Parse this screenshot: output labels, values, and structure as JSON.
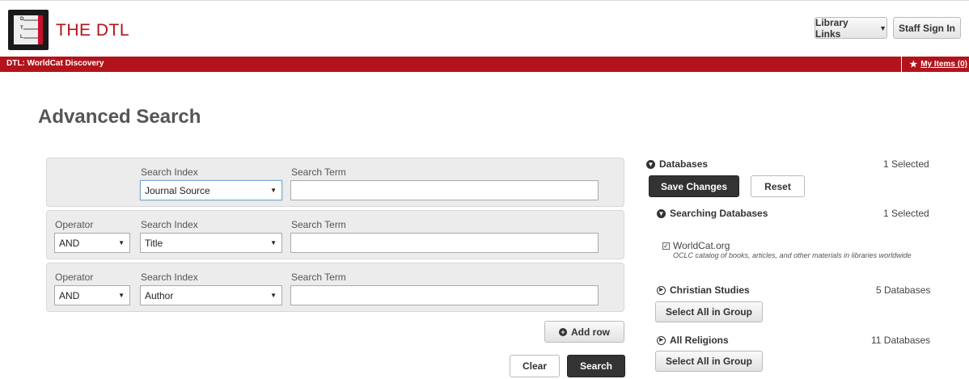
{
  "header": {
    "brand": "THE DTL",
    "logo_letters": [
      "D",
      "T",
      "L"
    ],
    "library_links_label": "Library Links",
    "staff_signin_label": "Staff Sign In"
  },
  "nav": {
    "breadcrumb": "DTL: WorldCat Discovery",
    "my_items_label": "My Items (0)"
  },
  "page_title": "Advanced Search",
  "search_rows": [
    {
      "search_index_label": "Search Index",
      "search_index_value": "Journal Source",
      "search_term_label": "Search Term",
      "search_term_value": ""
    },
    {
      "operator_label": "Operator",
      "operator_value": "AND",
      "search_index_label": "Search Index",
      "search_index_value": "Title",
      "search_term_label": "Search Term",
      "search_term_value": ""
    },
    {
      "operator_label": "Operator",
      "operator_value": "AND",
      "search_index_label": "Search Index",
      "search_index_value": "Author",
      "search_term_label": "Search Term",
      "search_term_value": ""
    }
  ],
  "actions": {
    "add_row_label": "Add row",
    "clear_label": "Clear",
    "search_label": "Search"
  },
  "databases": {
    "title": "Databases",
    "selected_count": "1 Selected",
    "save_label": "Save Changes",
    "reset_label": "Reset",
    "searching": {
      "title": "Searching Databases",
      "count": "1 Selected",
      "items": [
        {
          "name": "WorldCat.org",
          "checked": true,
          "description": "OCLC catalog of books, articles, and other materials in libraries worldwide"
        }
      ]
    },
    "groups": [
      {
        "title": "Christian Studies",
        "count": "5 Databases",
        "button_label": "Select All in Group"
      },
      {
        "title": "All Religions",
        "count": "11 Databases",
        "button_label": "Select All in Group"
      }
    ]
  },
  "colors": {
    "brand_red": "#b3131b",
    "dark_button": "#333333"
  }
}
